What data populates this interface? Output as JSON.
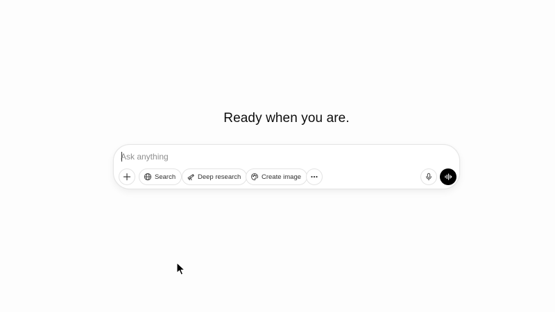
{
  "main": {
    "headline": "Ready when you are."
  },
  "composer": {
    "placeholder": "Ask anything",
    "value": ""
  },
  "toolbar": {
    "add_icon": "plus-icon",
    "search_label": "Search",
    "search_icon": "globe-icon",
    "deep_research_label": "Deep research",
    "deep_research_icon": "telescope-icon",
    "create_image_label": "Create image",
    "create_image_icon": "palette-icon",
    "more_icon": "ellipsis-icon",
    "mic_icon": "microphone-icon",
    "voice_icon": "voice-waveform-icon"
  },
  "colors": {
    "background": "#fdfdfd",
    "text": "#0d0d0d",
    "voice_button": "#000000",
    "border": "#e3e3e3"
  }
}
